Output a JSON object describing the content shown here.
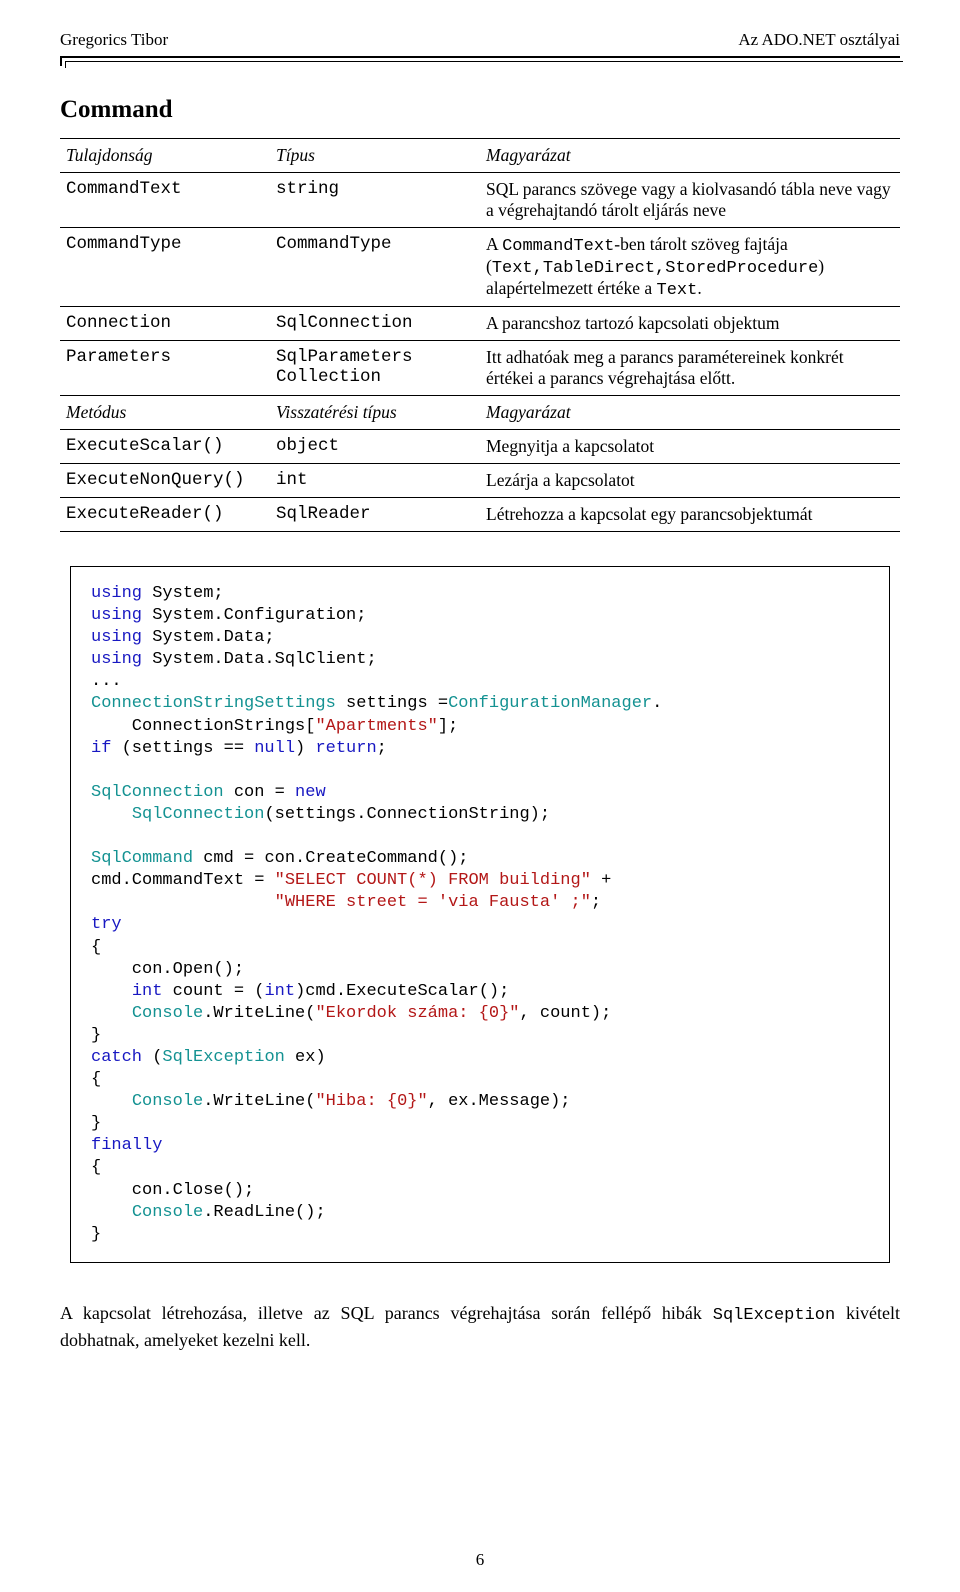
{
  "header": {
    "left": "Gregorics Tibor",
    "right": "Az ADO.NET osztályai"
  },
  "sectionTitle": "Command",
  "table1": {
    "headers": [
      "Tulajdonság",
      "Típus",
      "Magyarázat"
    ],
    "rows": [
      {
        "c0": "CommandText",
        "c1": "string",
        "c2": "SQL parancs szövege vagy a kiolvasandó tábla neve vagy a végrehajtandó tárolt eljárás neve"
      },
      {
        "c0": "CommandType",
        "c1": "CommandType",
        "c2_pre": "A ",
        "c2_code1": "CommandText",
        "c2_mid": "-ben tárolt szöveg fajtája (",
        "c2_code2": "Text,TableDirect,StoredProcedure",
        "c2_mid2": ") alapértelmezett értéke a ",
        "c2_code3": "Text",
        "c2_post": "."
      },
      {
        "c0": "Connection",
        "c1": "SqlConnection",
        "c2": "A parancshoz tartozó kapcsolati objektum"
      },
      {
        "c0": "Parameters",
        "c1": "SqlParameters Collection",
        "c2": "Itt adhatóak meg a parancs paramétereinek konkrét értékei a parancs végrehajtása előtt."
      }
    ]
  },
  "table2": {
    "headers": [
      "Metódus",
      "Visszatérési típus",
      "Magyarázat"
    ],
    "rows": [
      {
        "c0": "ExecuteScalar()",
        "c1": "object",
        "c2": "Megnyitja a kapcsolatot"
      },
      {
        "c0": "ExecuteNonQuery()",
        "c1": "int",
        "c2": "Lezárja a kapcsolatot"
      },
      {
        "c0": "ExecuteReader()",
        "c1": "SqlReader",
        "c2": "Létrehozza a kapcsolat egy parancsobjektumát"
      }
    ]
  },
  "code": {
    "l1a": "using",
    "l1b": " System;",
    "l2a": "using",
    "l2b": " System.Configuration;",
    "l3a": "using",
    "l3b": " System.Data;",
    "l4a": "using",
    "l4b": " System.Data.SqlClient;",
    "l5": "...",
    "l6a": "ConnectionStringSettings",
    "l6b": " settings =",
    "l6c": "ConfigurationManager",
    "l6d": ".",
    "l7a": "    ConnectionStrings[",
    "l7b": "\"Apartments\"",
    "l7c": "];",
    "l8a": "if",
    "l8b": " (settings == ",
    "l8c": "null",
    "l8d": ") ",
    "l8e": "return",
    "l8f": ";",
    "l9a": "SqlConnection",
    "l9b": " con = ",
    "l9c": "new",
    "l10a": "    ",
    "l10b": "SqlConnection",
    "l10c": "(settings.ConnectionString);",
    "l11a": "SqlCommand",
    "l11b": " cmd = con.CreateCommand();",
    "l12a": "cmd.CommandText = ",
    "l12b": "\"SELECT COUNT(*) FROM building\"",
    "l12c": " + ",
    "l13a": "                  ",
    "l13b": "\"WHERE street = 'via Fausta' ;\"",
    "l13c": ";",
    "l14a": "try",
    "l15": "{",
    "l16": "    con.Open();",
    "l17a": "    ",
    "l17b": "int",
    "l17c": " count = (",
    "l17d": "int",
    "l17e": ")cmd.ExecuteScalar();",
    "l18a": "    ",
    "l18b": "Console",
    "l18c": ".WriteLine(",
    "l18d": "\"Ekordok száma: {0}\"",
    "l18e": ", count);",
    "l19": "}",
    "l20a": "catch",
    "l20b": " (",
    "l20c": "SqlException",
    "l20d": " ex)",
    "l21": "{",
    "l22a": "    ",
    "l22b": "Console",
    "l22c": ".WriteLine(",
    "l22d": "\"Hiba: {0}\"",
    "l22e": ", ex.Message);",
    "l23": "}",
    "l24a": "finally",
    "l25": "{",
    "l26": "    con.Close();",
    "l27a": "    ",
    "l27b": "Console",
    "l27c": ".ReadLine();",
    "l28": "}"
  },
  "paragraph": {
    "pre": "A kapcsolat létrehozása, illetve az SQL parancs végrehajtása során fellépő hibák ",
    "code": "SqlException",
    "post": " kivételt dobhatnak, amelyeket kezelni kell."
  },
  "pageNumber": "6"
}
